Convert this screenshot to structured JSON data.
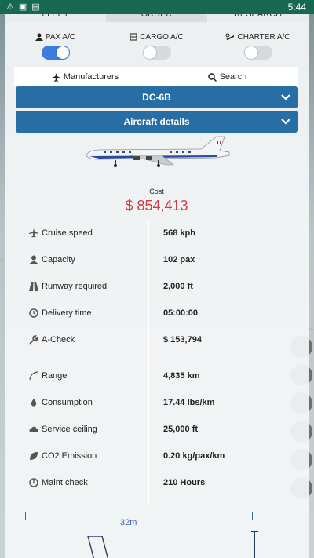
{
  "status_bar": {
    "time": "5:44",
    "icons": [
      "warning-icon",
      "image-icon",
      "card-icon"
    ]
  },
  "tabs": [
    {
      "label": "FLEET"
    },
    {
      "label": "ORDER"
    },
    {
      "label": "RESEARCH"
    }
  ],
  "aircraft_types": [
    {
      "label": "PAX A/C",
      "icon": "person-icon",
      "enabled": true
    },
    {
      "label": "CARGO A/C",
      "icon": "cargo-icon",
      "enabled": false
    },
    {
      "label": "CHARTER A/C",
      "icon": "charter-icon",
      "enabled": false
    }
  ],
  "subtabs": {
    "manufacturers_label": "Manufacturers",
    "search_label": "Search"
  },
  "model_dropdown": {
    "label": "DC-6B"
  },
  "details_dropdown": {
    "label": "Aircraft details"
  },
  "cost": {
    "label": "Cost",
    "value": "$ 854,413"
  },
  "stats": [
    {
      "label": "Cruise speed",
      "value": "568 kph",
      "icon": "plane-icon"
    },
    {
      "label": "Capacity",
      "value": "102 pax",
      "icon": "person-icon"
    },
    {
      "label": "Runway required",
      "value": "2,000 ft",
      "icon": "runway-icon"
    },
    {
      "label": "Delivery time",
      "value": "05:00:00",
      "icon": "clock-icon"
    },
    {
      "label": "A-Check",
      "value": "$ 153,794",
      "icon": "wrench-icon"
    },
    {
      "label": "Range",
      "value": "4,835 km",
      "icon": "arc-icon"
    },
    {
      "label": "Consumption",
      "value": "17.44 lbs/km",
      "icon": "drop-icon"
    },
    {
      "label": "Service ceiling",
      "value": "25,000 ft",
      "icon": "cloud-icon"
    },
    {
      "label": "CO2 Emission",
      "value": "0.20 kg/pax/km",
      "icon": "leaf-icon"
    },
    {
      "label": "Maint check",
      "value": "210 Hours",
      "icon": "clock-icon"
    }
  ],
  "wingspan": {
    "label": "32m"
  },
  "colors": {
    "accent": "#266ea4",
    "toggle_on": "#3b7ddd",
    "cost": "#d9383f",
    "status_bar": "#16694f"
  }
}
